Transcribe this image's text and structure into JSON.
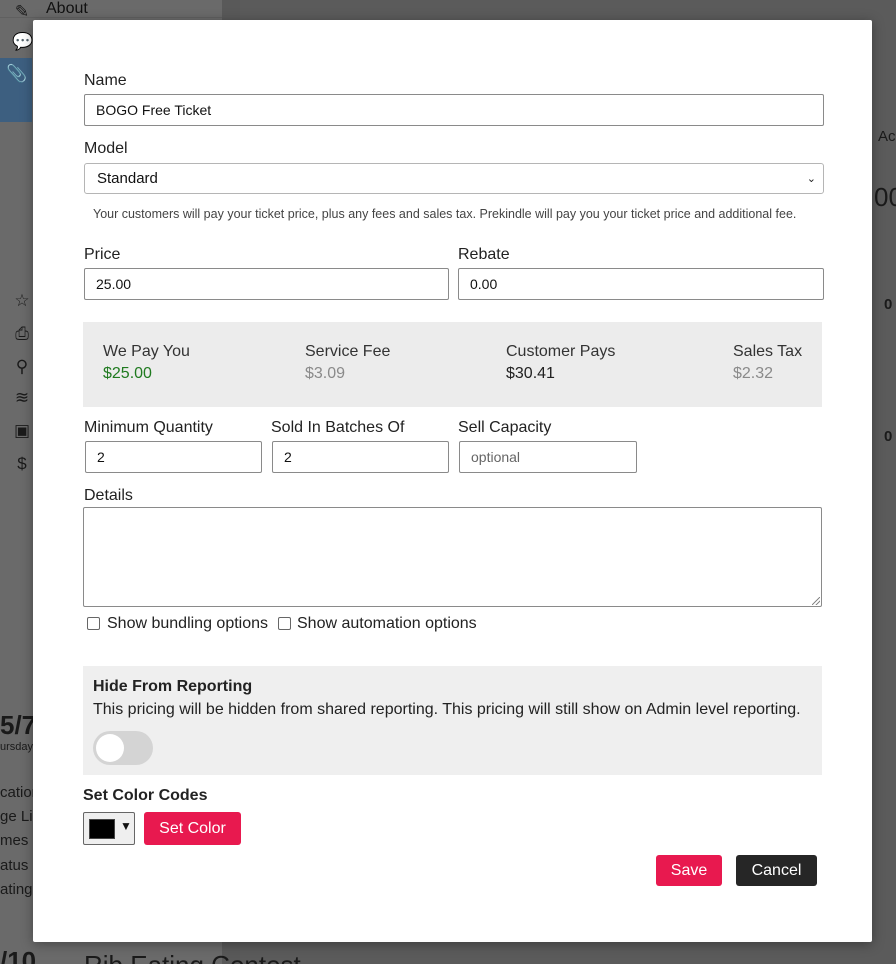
{
  "background": {
    "sidebar_items": [
      {
        "label": "About",
        "icon": "pencil-icon"
      }
    ],
    "fragments": {
      "date_big": "5/7",
      "day": "ursday",
      "cut1": "cation",
      "cut2": "ge Lin",
      "cut3": "mes",
      "cut4": "atus",
      "cut5": "ating",
      "date_big2": "/10",
      "event": "Rib Eating Contest",
      "right1": "Ac",
      "right2": "00",
      "right3": "0",
      "right4": "0"
    }
  },
  "modal": {
    "name_label": "Name",
    "name_value": "BOGO Free Ticket",
    "model_label": "Model",
    "model_value": "Standard",
    "model_note": "Your customers will pay your ticket price, plus any fees and sales tax. Prekindle will pay you your ticket price and additional fee.",
    "price_label": "Price",
    "price_value": "25.00",
    "rebate_label": "Rebate",
    "rebate_value": "0.00",
    "summary": [
      {
        "label": "We Pay You",
        "value": "$25.00",
        "color": "#1f7a1f"
      },
      {
        "label": "Service Fee",
        "value": "$3.09",
        "color": "#8a8a8a"
      },
      {
        "label": "Customer Pays",
        "value": "$30.41",
        "color": "#222222"
      },
      {
        "label": "Sales Tax",
        "value": "$2.32",
        "color": "#8a8a8a"
      }
    ],
    "min_qty_label": "Minimum Quantity",
    "min_qty_value": "2",
    "batch_label": "Sold In Batches Of",
    "batch_value": "2",
    "capacity_label": "Sell Capacity",
    "capacity_placeholder": "optional",
    "details_label": "Details",
    "details_value": "",
    "bundling_label": "Show bundling options",
    "bundling_checked": false,
    "automation_label": "Show automation options",
    "automation_checked": false,
    "hide_title": "Hide From Reporting",
    "hide_desc": "This pricing will be hidden from shared reporting. This pricing will still show on Admin level reporting.",
    "hide_toggle_on": false,
    "color_title": "Set Color Codes",
    "color_value": "#000000",
    "set_color_label": "Set Color",
    "save_label": "Save",
    "cancel_label": "Cancel"
  },
  "colors": {
    "accent": "#e8194f",
    "cancel": "#262626",
    "green": "#1f7a1f"
  }
}
